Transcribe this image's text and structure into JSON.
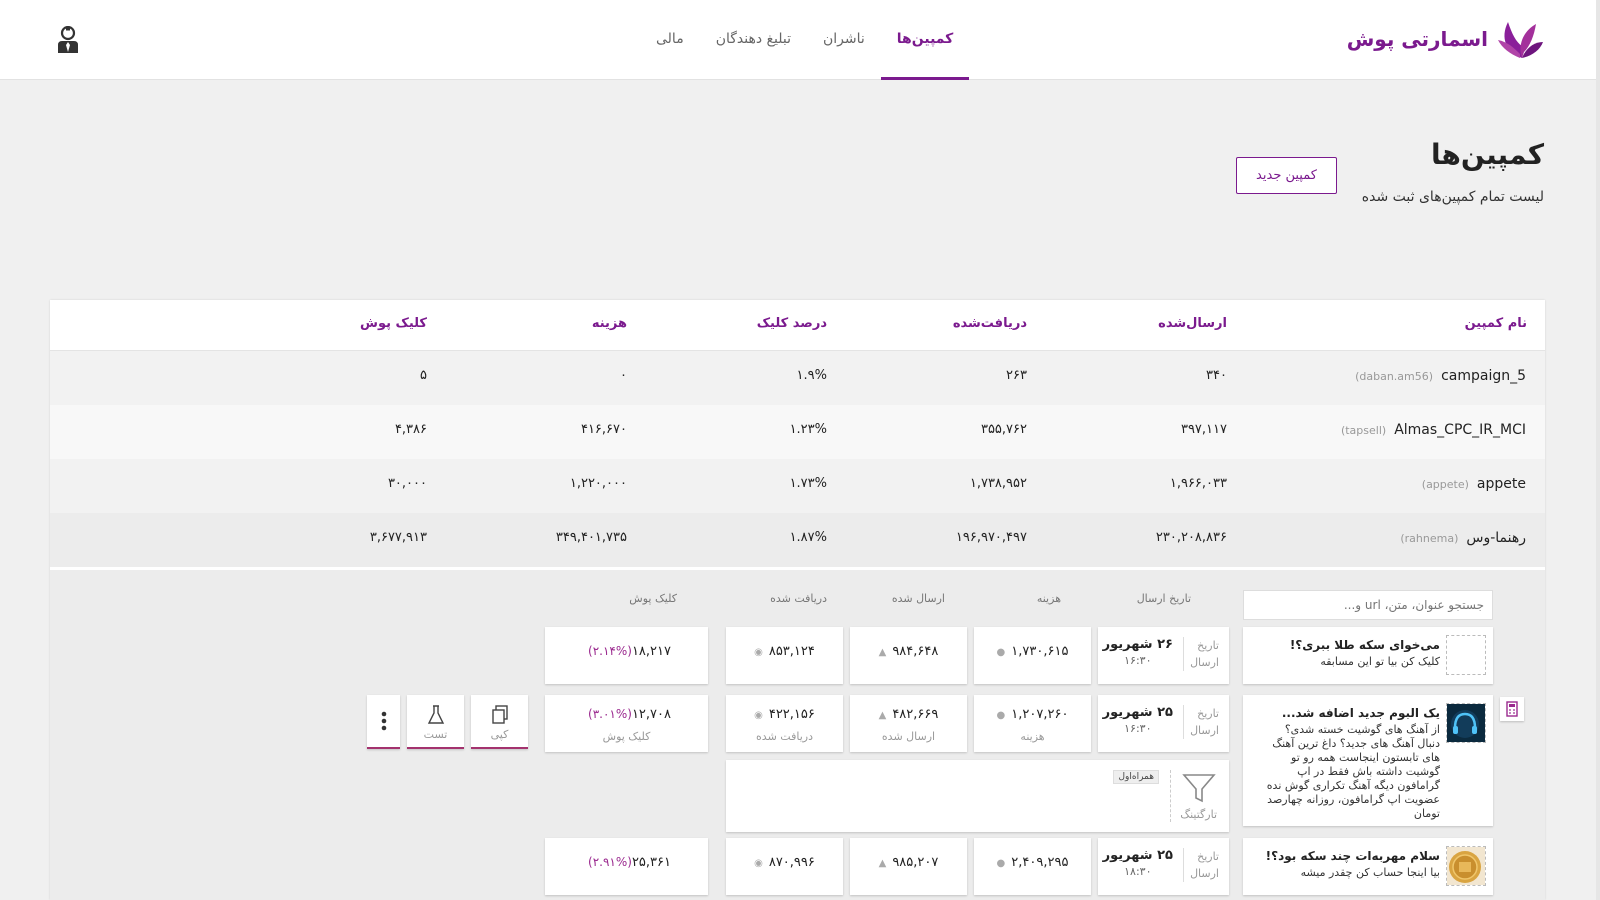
{
  "header": {
    "brand": "اسمارتی پوش",
    "nav": [
      {
        "label": "کمپین‌ها",
        "active": true
      },
      {
        "label": "ناشران",
        "active": false
      },
      {
        "label": "تبلیغ دهندگان",
        "active": false
      },
      {
        "label": "مالی",
        "active": false
      }
    ],
    "user_icon": "user-account-icon"
  },
  "page": {
    "title": "کمپین‌ها",
    "subtitle": "لیست تمام کمپین‌های ثبت شده",
    "new_button": "کمپین جدید"
  },
  "table": {
    "headers": [
      "نام کمپین",
      "ارسال‌شده",
      "دریافت‌شده",
      "درصد کلیک",
      "هزینه",
      "کلیک پوش"
    ],
    "rows": [
      {
        "name": "campaign_5",
        "publisher": "(daban.am56)",
        "sent": "۳۴۰",
        "received": "۲۶۳",
        "ctr": "۱.۹%",
        "cost": "۰",
        "clicks": "۵"
      },
      {
        "name": "Almas_CPC_IR_MCI",
        "publisher": "(tapsell)",
        "sent": "۳۹۷,۱۱۷",
        "received": "۳۵۵,۷۶۲",
        "ctr": "۱.۲۳%",
        "cost": "۴۱۶,۶۷۰",
        "clicks": "۴,۳۸۶"
      },
      {
        "name": "appete",
        "publisher": "(appete)",
        "sent": "۱,۹۶۶,۰۳۳",
        "received": "۱,۷۳۸,۹۵۲",
        "ctr": "۱.۷۳%",
        "cost": "۱,۲۲۰,۰۰۰",
        "clicks": "۳۰,۰۰۰"
      },
      {
        "name": "رهنما-وس",
        "publisher": "(rahnema)",
        "sent": "۲۳۰,۲۰۸,۸۳۶",
        "received": "۱۹۶,۹۷۰,۴۹۷",
        "ctr": "۱.۸۷%",
        "cost": "۳۴۹,۴۰۱,۷۳۵",
        "clicks": "۳,۶۷۷,۹۱۳"
      }
    ]
  },
  "sub": {
    "search_placeholder": "جستجو عنوان، متن، url و...",
    "headers": {
      "date": "تاریخ ارسال",
      "cost": "هزینه",
      "sent": "ارسال شده",
      "received": "دریافت شده",
      "clicks": "کلیک پوش"
    },
    "date_label_1": "تاریخ",
    "date_label_2": "ارسال",
    "pushes": [
      {
        "title": "می‌خوای سکه طلا ببری؟!",
        "text": "کلیک کن بیا تو این مسابقه",
        "date": "۲۶ شهریور",
        "time": "۱۶:۳۰",
        "cost": "۱,۷۳۰,۶۱۵",
        "sent": "۹۸۴,۶۴۸",
        "received": "۸۵۳,۱۲۴",
        "clicks": "۱۸,۲۱۷",
        "pct": "(۲.۱۴%)"
      },
      {
        "title": "یک البوم جدید اضافه شد...",
        "text": "از آهنگ های گوشیت خسته شدی؟ دنبال آهنگ های جدید؟ داغ ترین آهنگ های تابستون اینجاست همه رو تو گوشیت داشته باش فقط در اپ گرامافون دیگه آهنگ تکراری گوش نده عضویت اپ گرامافون، روزانه چهارصد تومان",
        "date": "۲۵ شهریور",
        "time": "۱۶:۳۰",
        "cost": "۱,۲۰۷,۲۶۰",
        "sent": "۴۸۲,۶۶۹",
        "received": "۴۲۲,۱۵۶",
        "clicks": "۱۲,۷۰۸",
        "pct": "(۳.۰۱%)",
        "cost_label": "هزینه",
        "sent_label": "ارسال شده",
        "received_label": "دریافت شده",
        "clicks_label": "کلیک پوش"
      },
      {
        "title": "سلام مهربه‌ات چند سکه بود؟!",
        "text": "بیا اینجا حساب کن چقدر میشه",
        "date": "۲۵ شهریور",
        "time": "۱۸:۳۰",
        "cost": "۲,۴۰۹,۲۹۵",
        "sent": "۹۸۵,۲۰۷",
        "received": "۸۷۰,۹۹۶",
        "clicks": "۲۵,۳۶۱",
        "pct": "(۲.۹۱%)"
      }
    ],
    "actions": [
      {
        "label": "کپی",
        "icon": "copy-icon"
      },
      {
        "label": "تست",
        "icon": "flask-icon"
      },
      {
        "label": "",
        "icon": "more-vertical-icon"
      }
    ],
    "targeting": {
      "label": "تارگتینگ",
      "tag": "همراه‌اول",
      "icon": "funnel-icon"
    }
  },
  "colors": {
    "brand": "#7b1a8e",
    "accent": "#a3326e",
    "pct": "#9b2a8f"
  }
}
